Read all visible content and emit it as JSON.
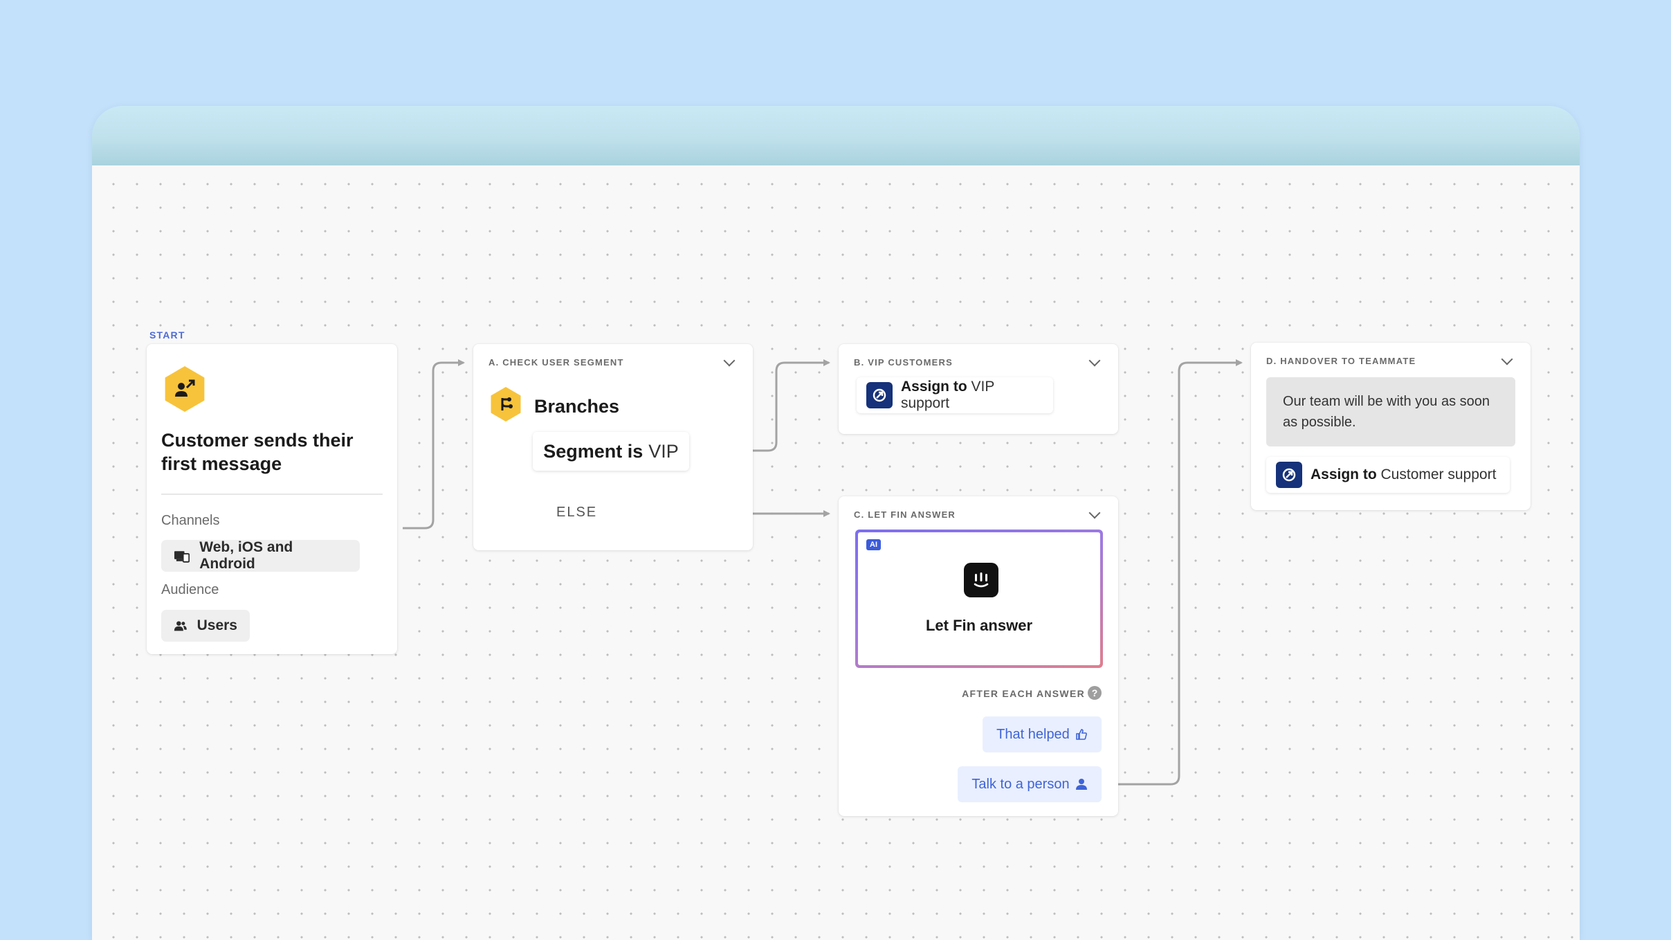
{
  "start": {
    "tag": "START",
    "title": "Customer sends their first message",
    "channels_label": "Channels",
    "channels_value": "Web, iOS and Android",
    "audience_label": "Audience",
    "audience_value": "Users"
  },
  "check_segment": {
    "tag": "A. CHECK USER SEGMENT",
    "title": "Branches",
    "condition_prefix": "Segment is",
    "condition_value": "VIP",
    "else_label": "ELSE"
  },
  "vip_customers": {
    "tag": "B. VIP CUSTOMERS",
    "action_verb": "Assign to",
    "action_target": "VIP support"
  },
  "fin_answer": {
    "tag": "C. LET FIN ANSWER",
    "ai_badge": "AI",
    "title": "Let Fin answer",
    "after_label": "AFTER EACH ANSWER",
    "help_glyph": "?",
    "option_helped": "That helped",
    "option_person": "Talk to a person"
  },
  "handover": {
    "tag": "D. HANDOVER TO TEAMMATE",
    "message": "Our team will be with you as soon as possible.",
    "action_verb": "Assign to",
    "action_target": "Customer support"
  },
  "colors": {
    "page_bg": "#c4e1fb",
    "node_icon": "#f7c33b",
    "assign_icon": "#15327a",
    "accent_blue": "#3f64d6",
    "connector": "#a3a3a3"
  },
  "icons": {
    "start": "user-arrow-icon",
    "branches": "branch-icon",
    "channels": "devices-icon",
    "audience": "users-icon",
    "assign": "assign-icon",
    "fin": "fin-logo-icon",
    "helped": "thumbs-up-icon",
    "person": "person-icon"
  }
}
